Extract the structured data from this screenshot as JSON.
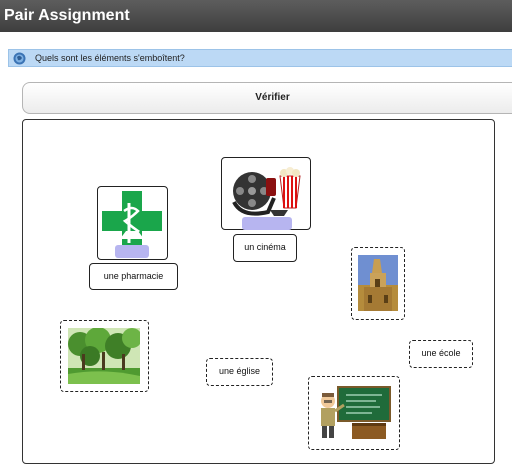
{
  "window": {
    "title": "Pair Assignment"
  },
  "question": {
    "icon": "help-globe-icon",
    "text": "Quels sont les éléments s'emboîtent?"
  },
  "toolbar": {
    "check_label": "Vérifier"
  },
  "board": {
    "labels": {
      "pharmacie": "une pharmacie",
      "cinema": "un cinéma",
      "eglise": "une église",
      "ecole": "une école"
    },
    "images": {
      "pharmacie": "pharmacy-cross-image",
      "cinema": "cinema-film-reel-image",
      "eglise": "church-tower-image",
      "park": "park-trees-image",
      "ecole": "teacher-chalkboard-image"
    }
  },
  "colors": {
    "titlebar": "#4a4a4a",
    "questionbar": "#bcd9f5",
    "handle": "#b7b5f0",
    "pharmacy_green": "#1aa64b"
  }
}
